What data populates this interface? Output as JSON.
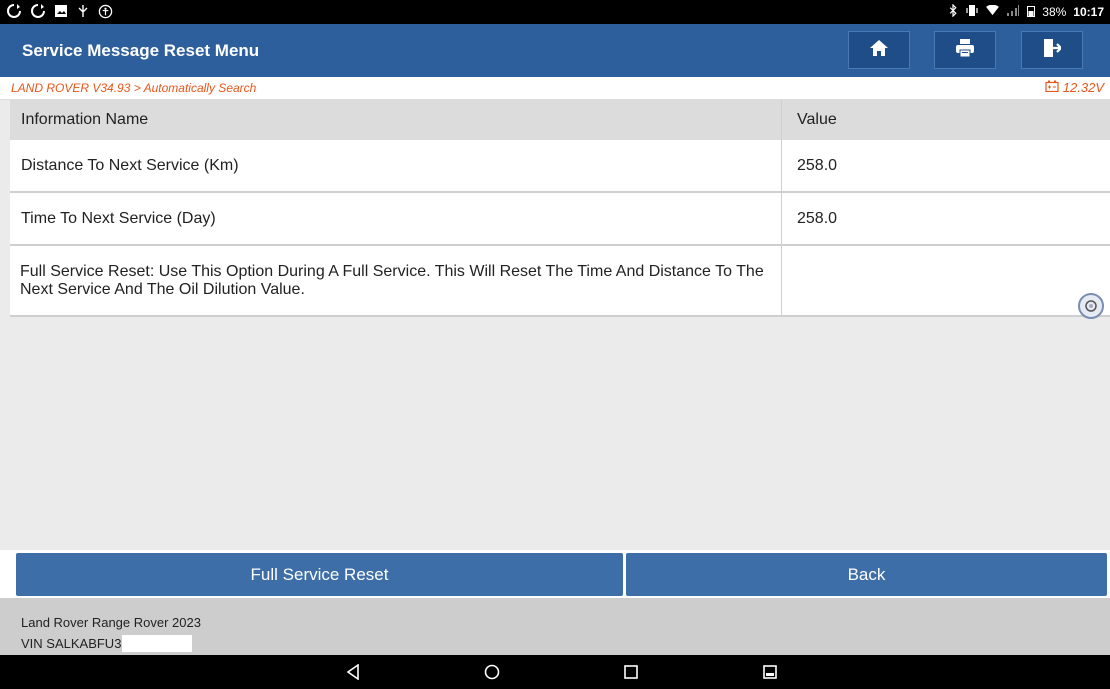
{
  "status_bar": {
    "left_icons": [
      "sync-icon",
      "sync-icon",
      "image-icon",
      "usb-icon",
      "accessibility-icon"
    ],
    "battery_percent": "38%",
    "time": "10:17"
  },
  "header": {
    "title": "Service Message Reset Menu",
    "buttons": [
      "home-icon",
      "print-icon",
      "exit-icon"
    ]
  },
  "breadcrumb": {
    "path": "LAND ROVER V34.93 > Automatically Search",
    "voltage": "12.32V"
  },
  "table": {
    "columns": [
      "Information Name",
      "Value"
    ],
    "rows": [
      {
        "name": "Distance To Next Service (Km)",
        "value": "258.0"
      },
      {
        "name": "Time To Next Service (Day)",
        "value": "258.0"
      },
      {
        "name": "Full Service Reset: Use This Option During A Full Service. This Will Reset The Time And Distance To The Next Service And The Oil Dilution Value.",
        "value": ""
      }
    ]
  },
  "actions": {
    "primary": "Full Service Reset",
    "secondary": "Back"
  },
  "footer": {
    "vehicle": "Land Rover Range Rover 2023",
    "vin": "VIN SALKABFU3"
  },
  "colors": {
    "header_bg": "#2d5f9d",
    "button_bg": "#3d6ea8",
    "breadcrumb_text": "#e8561a"
  }
}
